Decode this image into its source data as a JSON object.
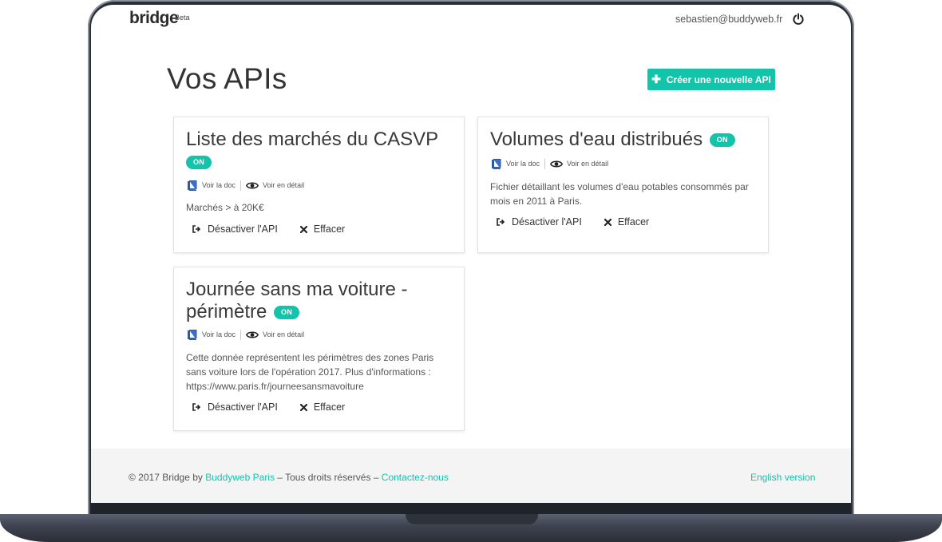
{
  "header": {
    "logo": "bridge",
    "beta": "Beta",
    "user_email": "sebastien@buddyweb.fr"
  },
  "main": {
    "title": "Vos APIs",
    "create_button": "Créer une nouvelle API"
  },
  "common": {
    "doc_link": "Voir la doc",
    "detail_link": "Voir en détail",
    "deactivate": "Désactiver l'API",
    "delete": "Effacer",
    "status_on": "ON"
  },
  "apis": [
    {
      "title": "Liste des marchés du CASVP",
      "status": "ON",
      "description": "Marchés > à 20K€"
    },
    {
      "title": "Volumes d'eau distribués",
      "status": "ON",
      "description": "Fichier détaillant les volumes d'eau potables consommés par mois en 2011 à Paris."
    },
    {
      "title_line1": "Journée sans ma voiture -",
      "title_line2": "périmètre",
      "status": "ON",
      "description": "Cette donnée représentent les périmètres des zones Paris sans voiture lors de l'opération 2017. Plus d'informations : https://www.paris.fr/journeesansmavoiture"
    }
  ],
  "footer": {
    "copyright": "© 2017 Bridge by ",
    "company_link": "Buddyweb Paris",
    "rights": " – Tous droits réservés – ",
    "contact_link": "Contactez-nous",
    "language_link": "English version"
  },
  "colors": {
    "accent": "#14c4aa",
    "doc_icon": "#3b6fc9",
    "frame": "#2a2e37"
  }
}
